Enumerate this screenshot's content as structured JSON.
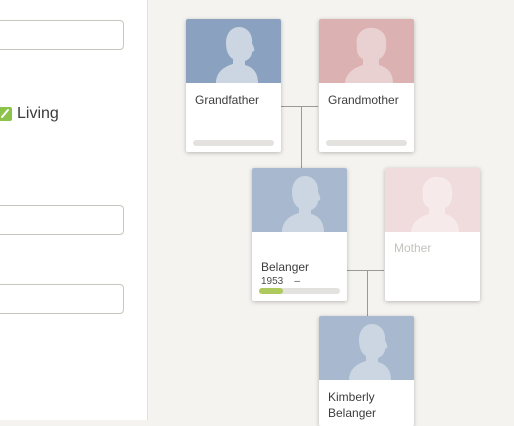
{
  "form": {
    "living_label": "Living"
  },
  "colors": {
    "male_photo": "#a7b8cf",
    "male_photo_dark": "#8aa2bf",
    "female_photo": "#dbb1b2",
    "female_photo_faded": "#f0dcdd",
    "silhouette_male": "#ccd6e3",
    "silhouette_female": "#ead1d1",
    "progress_fill": "#aec95d",
    "checkbox": "#8cc34a"
  },
  "tree": {
    "grandfather": {
      "name": "Grandfather",
      "icon": "male-silhouette-icon"
    },
    "grandmother": {
      "name": "Grandmother",
      "icon": "female-silhouette-icon"
    },
    "father": {
      "name": "Belanger",
      "years": "1953    –",
      "progress": 0.3,
      "icon": "male-silhouette-icon"
    },
    "mother": {
      "name": "Mother",
      "icon": "female-silhouette-icon"
    },
    "child": {
      "name": "Kimberly\nBelanger",
      "icon": "male-silhouette-icon"
    }
  }
}
